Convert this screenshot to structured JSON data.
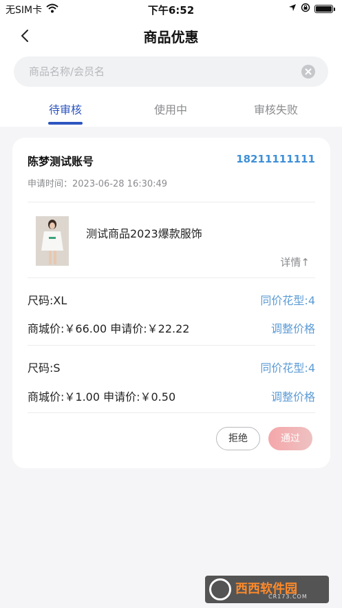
{
  "status_bar": {
    "carrier": "无SIM卡",
    "time": "下午6:52"
  },
  "nav": {
    "title": "商品优惠"
  },
  "search": {
    "placeholder": "商品名称/会员名"
  },
  "tabs": [
    {
      "label": "待审核",
      "active": true
    },
    {
      "label": "使用中",
      "active": false
    },
    {
      "label": "审核失败",
      "active": false
    }
  ],
  "order": {
    "user_name": "陈梦测试账号",
    "phone": "18211111111",
    "apply_time": "申请时间：2023-06-28 16:30:49",
    "product_name": "测试商品2023爆款服饰",
    "detail_label": "详情↑",
    "skus": [
      {
        "size": "尺码:XL",
        "same_price": "同价花型:4",
        "prices": "商城价:￥66.00 申请价:￥22.22",
        "adjust": "调整价格"
      },
      {
        "size": "尺码:S",
        "same_price": "同价花型:4",
        "prices": "商城价:￥1.00 申请价:￥0.50",
        "adjust": "调整价格"
      }
    ],
    "reject_label": "拒绝",
    "pass_label": "通过"
  },
  "watermark": {
    "text": "西西软件园",
    "sub": "CR173.COM"
  },
  "colors": {
    "accent": "#2d55c0",
    "link": "#5b9bd5",
    "pass_gradient_start": "#f5a7aa"
  },
  "icons": [
    "wifi-icon",
    "location-icon",
    "lock-rotation-icon",
    "battery-icon",
    "back-icon",
    "clear-icon"
  ]
}
